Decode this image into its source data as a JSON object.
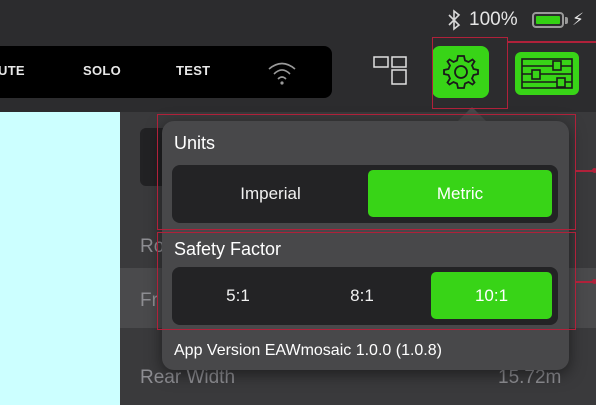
{
  "status_bar": {
    "bluetooth_icon": "bluetooth-icon",
    "battery_percent": "100%",
    "battery_level": 1.0,
    "charging_icon": "bolt-icon"
  },
  "toolbar": {
    "modes": [
      {
        "label": "UTE"
      },
      {
        "label": "SOLO"
      },
      {
        "label": "TEST"
      }
    ],
    "wifi_icon": "wifi-icon",
    "layout_icon": "grid-layout-icon",
    "settings_icon": "gear-icon",
    "mixer_icon": "mixer-sliders-icon"
  },
  "background": {
    "row_labels": [
      "Ro",
      "Fr",
      "Rear Width"
    ],
    "row_value": "15.72m"
  },
  "settings_popover": {
    "units": {
      "title": "Units",
      "options": [
        "Imperial",
        "Metric"
      ],
      "selected": "Metric"
    },
    "safety_factor": {
      "title": "Safety Factor",
      "options": [
        "5:1",
        "8:1",
        "10:1"
      ],
      "selected": "10:1"
    },
    "app_version": "App Version EAWmosaic 1.0.0 (1.0.8)"
  },
  "colors": {
    "accent_green": "#38d417",
    "background_dark": "#2c2c2e",
    "popover": "#48484a",
    "annotation_red": "#b0213a",
    "cyan_panel": "#ccffff"
  }
}
